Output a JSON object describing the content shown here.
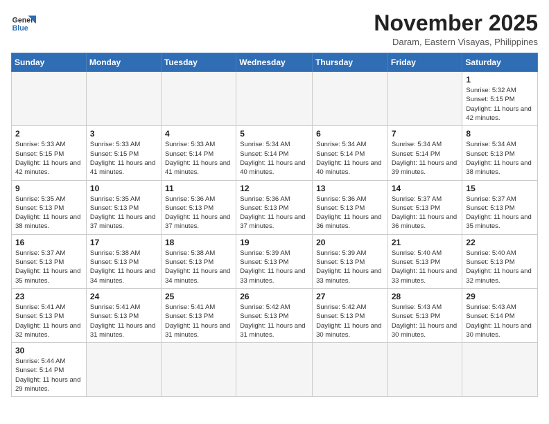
{
  "logo": {
    "text_general": "General",
    "text_blue": "Blue"
  },
  "title": "November 2025",
  "location": "Daram, Eastern Visayas, Philippines",
  "days_of_week": [
    "Sunday",
    "Monday",
    "Tuesday",
    "Wednesday",
    "Thursday",
    "Friday",
    "Saturday"
  ],
  "weeks": [
    [
      {
        "day": "",
        "info": ""
      },
      {
        "day": "",
        "info": ""
      },
      {
        "day": "",
        "info": ""
      },
      {
        "day": "",
        "info": ""
      },
      {
        "day": "",
        "info": ""
      },
      {
        "day": "",
        "info": ""
      },
      {
        "day": "1",
        "info": "Sunrise: 5:32 AM\nSunset: 5:15 PM\nDaylight: 11 hours and 42 minutes."
      }
    ],
    [
      {
        "day": "2",
        "info": "Sunrise: 5:33 AM\nSunset: 5:15 PM\nDaylight: 11 hours and 42 minutes."
      },
      {
        "day": "3",
        "info": "Sunrise: 5:33 AM\nSunset: 5:15 PM\nDaylight: 11 hours and 41 minutes."
      },
      {
        "day": "4",
        "info": "Sunrise: 5:33 AM\nSunset: 5:14 PM\nDaylight: 11 hours and 41 minutes."
      },
      {
        "day": "5",
        "info": "Sunrise: 5:34 AM\nSunset: 5:14 PM\nDaylight: 11 hours and 40 minutes."
      },
      {
        "day": "6",
        "info": "Sunrise: 5:34 AM\nSunset: 5:14 PM\nDaylight: 11 hours and 40 minutes."
      },
      {
        "day": "7",
        "info": "Sunrise: 5:34 AM\nSunset: 5:14 PM\nDaylight: 11 hours and 39 minutes."
      },
      {
        "day": "8",
        "info": "Sunrise: 5:34 AM\nSunset: 5:13 PM\nDaylight: 11 hours and 38 minutes."
      }
    ],
    [
      {
        "day": "9",
        "info": "Sunrise: 5:35 AM\nSunset: 5:13 PM\nDaylight: 11 hours and 38 minutes."
      },
      {
        "day": "10",
        "info": "Sunrise: 5:35 AM\nSunset: 5:13 PM\nDaylight: 11 hours and 37 minutes."
      },
      {
        "day": "11",
        "info": "Sunrise: 5:36 AM\nSunset: 5:13 PM\nDaylight: 11 hours and 37 minutes."
      },
      {
        "day": "12",
        "info": "Sunrise: 5:36 AM\nSunset: 5:13 PM\nDaylight: 11 hours and 37 minutes."
      },
      {
        "day": "13",
        "info": "Sunrise: 5:36 AM\nSunset: 5:13 PM\nDaylight: 11 hours and 36 minutes."
      },
      {
        "day": "14",
        "info": "Sunrise: 5:37 AM\nSunset: 5:13 PM\nDaylight: 11 hours and 36 minutes."
      },
      {
        "day": "15",
        "info": "Sunrise: 5:37 AM\nSunset: 5:13 PM\nDaylight: 11 hours and 35 minutes."
      }
    ],
    [
      {
        "day": "16",
        "info": "Sunrise: 5:37 AM\nSunset: 5:13 PM\nDaylight: 11 hours and 35 minutes."
      },
      {
        "day": "17",
        "info": "Sunrise: 5:38 AM\nSunset: 5:13 PM\nDaylight: 11 hours and 34 minutes."
      },
      {
        "day": "18",
        "info": "Sunrise: 5:38 AM\nSunset: 5:13 PM\nDaylight: 11 hours and 34 minutes."
      },
      {
        "day": "19",
        "info": "Sunrise: 5:39 AM\nSunset: 5:13 PM\nDaylight: 11 hours and 33 minutes."
      },
      {
        "day": "20",
        "info": "Sunrise: 5:39 AM\nSunset: 5:13 PM\nDaylight: 11 hours and 33 minutes."
      },
      {
        "day": "21",
        "info": "Sunrise: 5:40 AM\nSunset: 5:13 PM\nDaylight: 11 hours and 33 minutes."
      },
      {
        "day": "22",
        "info": "Sunrise: 5:40 AM\nSunset: 5:13 PM\nDaylight: 11 hours and 32 minutes."
      }
    ],
    [
      {
        "day": "23",
        "info": "Sunrise: 5:41 AM\nSunset: 5:13 PM\nDaylight: 11 hours and 32 minutes."
      },
      {
        "day": "24",
        "info": "Sunrise: 5:41 AM\nSunset: 5:13 PM\nDaylight: 11 hours and 31 minutes."
      },
      {
        "day": "25",
        "info": "Sunrise: 5:41 AM\nSunset: 5:13 PM\nDaylight: 11 hours and 31 minutes."
      },
      {
        "day": "26",
        "info": "Sunrise: 5:42 AM\nSunset: 5:13 PM\nDaylight: 11 hours and 31 minutes."
      },
      {
        "day": "27",
        "info": "Sunrise: 5:42 AM\nSunset: 5:13 PM\nDaylight: 11 hours and 30 minutes."
      },
      {
        "day": "28",
        "info": "Sunrise: 5:43 AM\nSunset: 5:13 PM\nDaylight: 11 hours and 30 minutes."
      },
      {
        "day": "29",
        "info": "Sunrise: 5:43 AM\nSunset: 5:14 PM\nDaylight: 11 hours and 30 minutes."
      }
    ],
    [
      {
        "day": "30",
        "info": "Sunrise: 5:44 AM\nSunset: 5:14 PM\nDaylight: 11 hours and 29 minutes."
      },
      {
        "day": "",
        "info": ""
      },
      {
        "day": "",
        "info": ""
      },
      {
        "day": "",
        "info": ""
      },
      {
        "day": "",
        "info": ""
      },
      {
        "day": "",
        "info": ""
      },
      {
        "day": "",
        "info": ""
      }
    ]
  ]
}
